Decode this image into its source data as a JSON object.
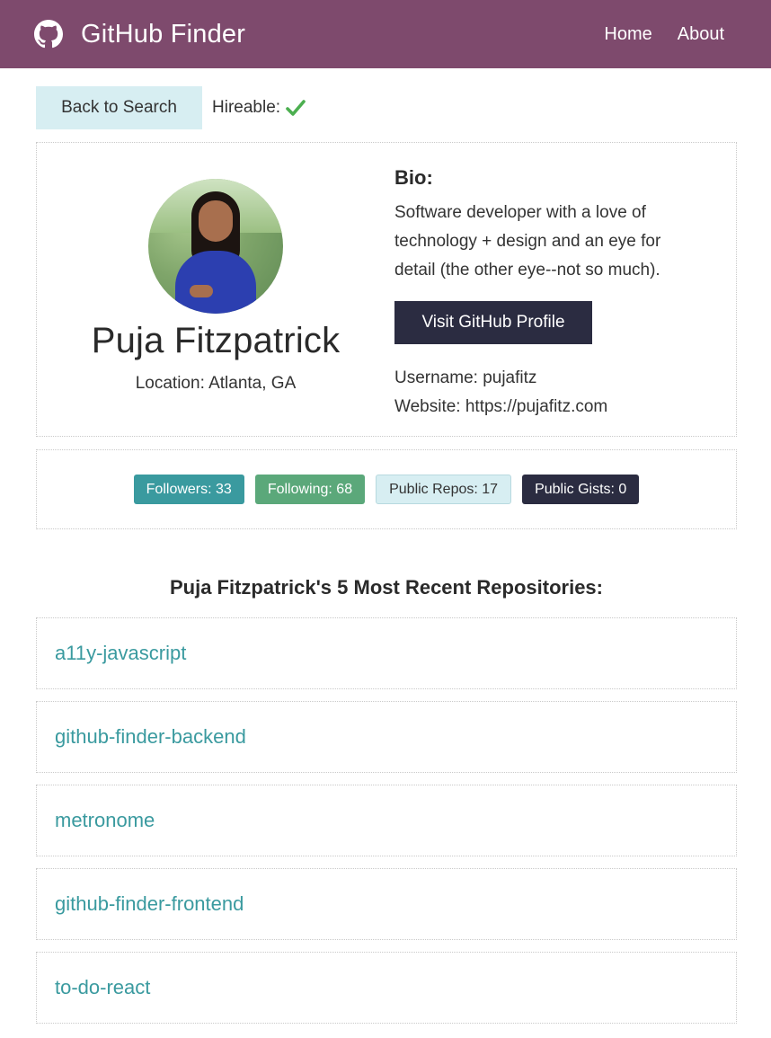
{
  "navbar": {
    "icon": "github-icon",
    "title": "GitHub Finder",
    "links": [
      "Home",
      "About"
    ]
  },
  "top": {
    "back_label": "Back to Search",
    "hireable_label": "Hireable:",
    "hireable_icon": "check-icon",
    "hireable_color": "#4caf50"
  },
  "profile": {
    "name": "Puja Fitzpatrick",
    "location": "Location: Atlanta, GA",
    "bio_heading": "Bio:",
    "bio": "Software developer with a love of technology + design and an eye for detail (the other eye--not so much).",
    "visit_label": "Visit GitHub Profile",
    "username": "Username: pujafitz",
    "website": "Website: https://pujafitz.com"
  },
  "stats": {
    "followers": "Followers: 33",
    "following": "Following: 68",
    "repos": "Public Repos: 17",
    "gists": "Public Gists: 0"
  },
  "repos_heading": "Puja Fitzpatrick's 5 Most Recent Repositories:",
  "repos": [
    "a11y-javascript",
    "github-finder-backend",
    "metronome",
    "github-finder-frontend",
    "to-do-react"
  ],
  "colors": {
    "navbar": "#7e4a6d",
    "primary": "#3a9a9f",
    "success": "#5ba87a",
    "light": "#d7eef2",
    "dark": "#2b2c41"
  }
}
